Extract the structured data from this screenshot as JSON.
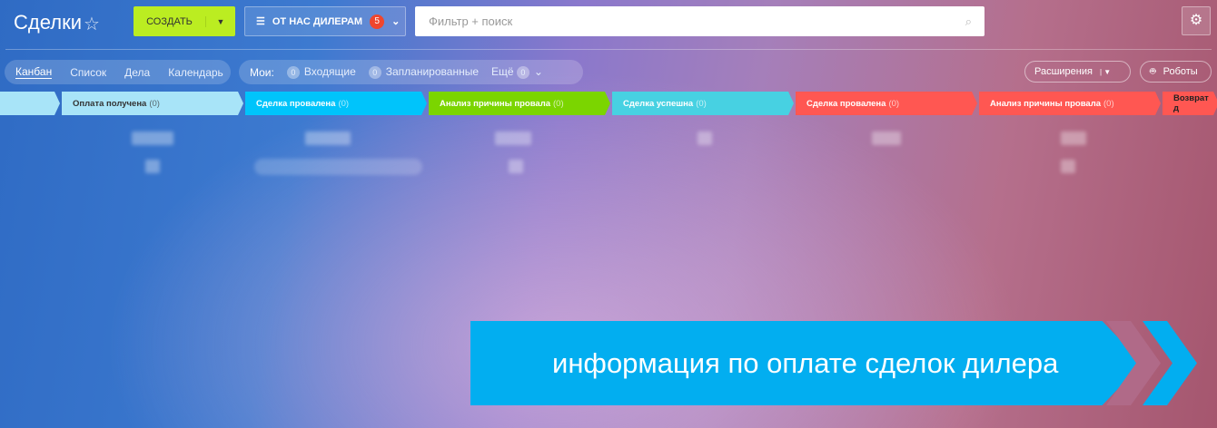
{
  "header": {
    "title": "Сделки",
    "create_label": "СОЗДАТЬ",
    "filter_label": "ОТ НАС ДИЛЕРАМ",
    "filter_count": "5",
    "search_placeholder": "Фильтр + поиск"
  },
  "views": [
    "Канбан",
    "Список",
    "Дела",
    "Календарь"
  ],
  "my": {
    "label": "Мои:",
    "incoming_count": "0",
    "incoming": "Входящие",
    "planned_count": "0",
    "planned": "Запланированные",
    "more": "Ещё",
    "more_count": "0"
  },
  "right": {
    "extensions": "Расширения",
    "robots": "Роботы"
  },
  "stages": [
    {
      "name": "",
      "count": "",
      "color": "#a8e4f8"
    },
    {
      "name": "Оплата получена",
      "count": "(0)",
      "color": "#a8e4f8"
    },
    {
      "name": "Сделка провалена",
      "count": "(0)",
      "color": "#00c4fb"
    },
    {
      "name": "Анализ причины провала",
      "count": "(0)",
      "color": "#7bd500"
    },
    {
      "name": "Сделка успешна",
      "count": "(0)",
      "color": "#47d1e2"
    },
    {
      "name": "Сделка провалена",
      "count": "(0)",
      "color": "#ff5752"
    },
    {
      "name": "Анализ причины провала",
      "count": "(0)",
      "color": "#ff5752"
    },
    {
      "name": "Возврат д",
      "count": "",
      "color": "#ff5752"
    }
  ],
  "banner": {
    "text": "информация по оплате сделок дилера"
  }
}
